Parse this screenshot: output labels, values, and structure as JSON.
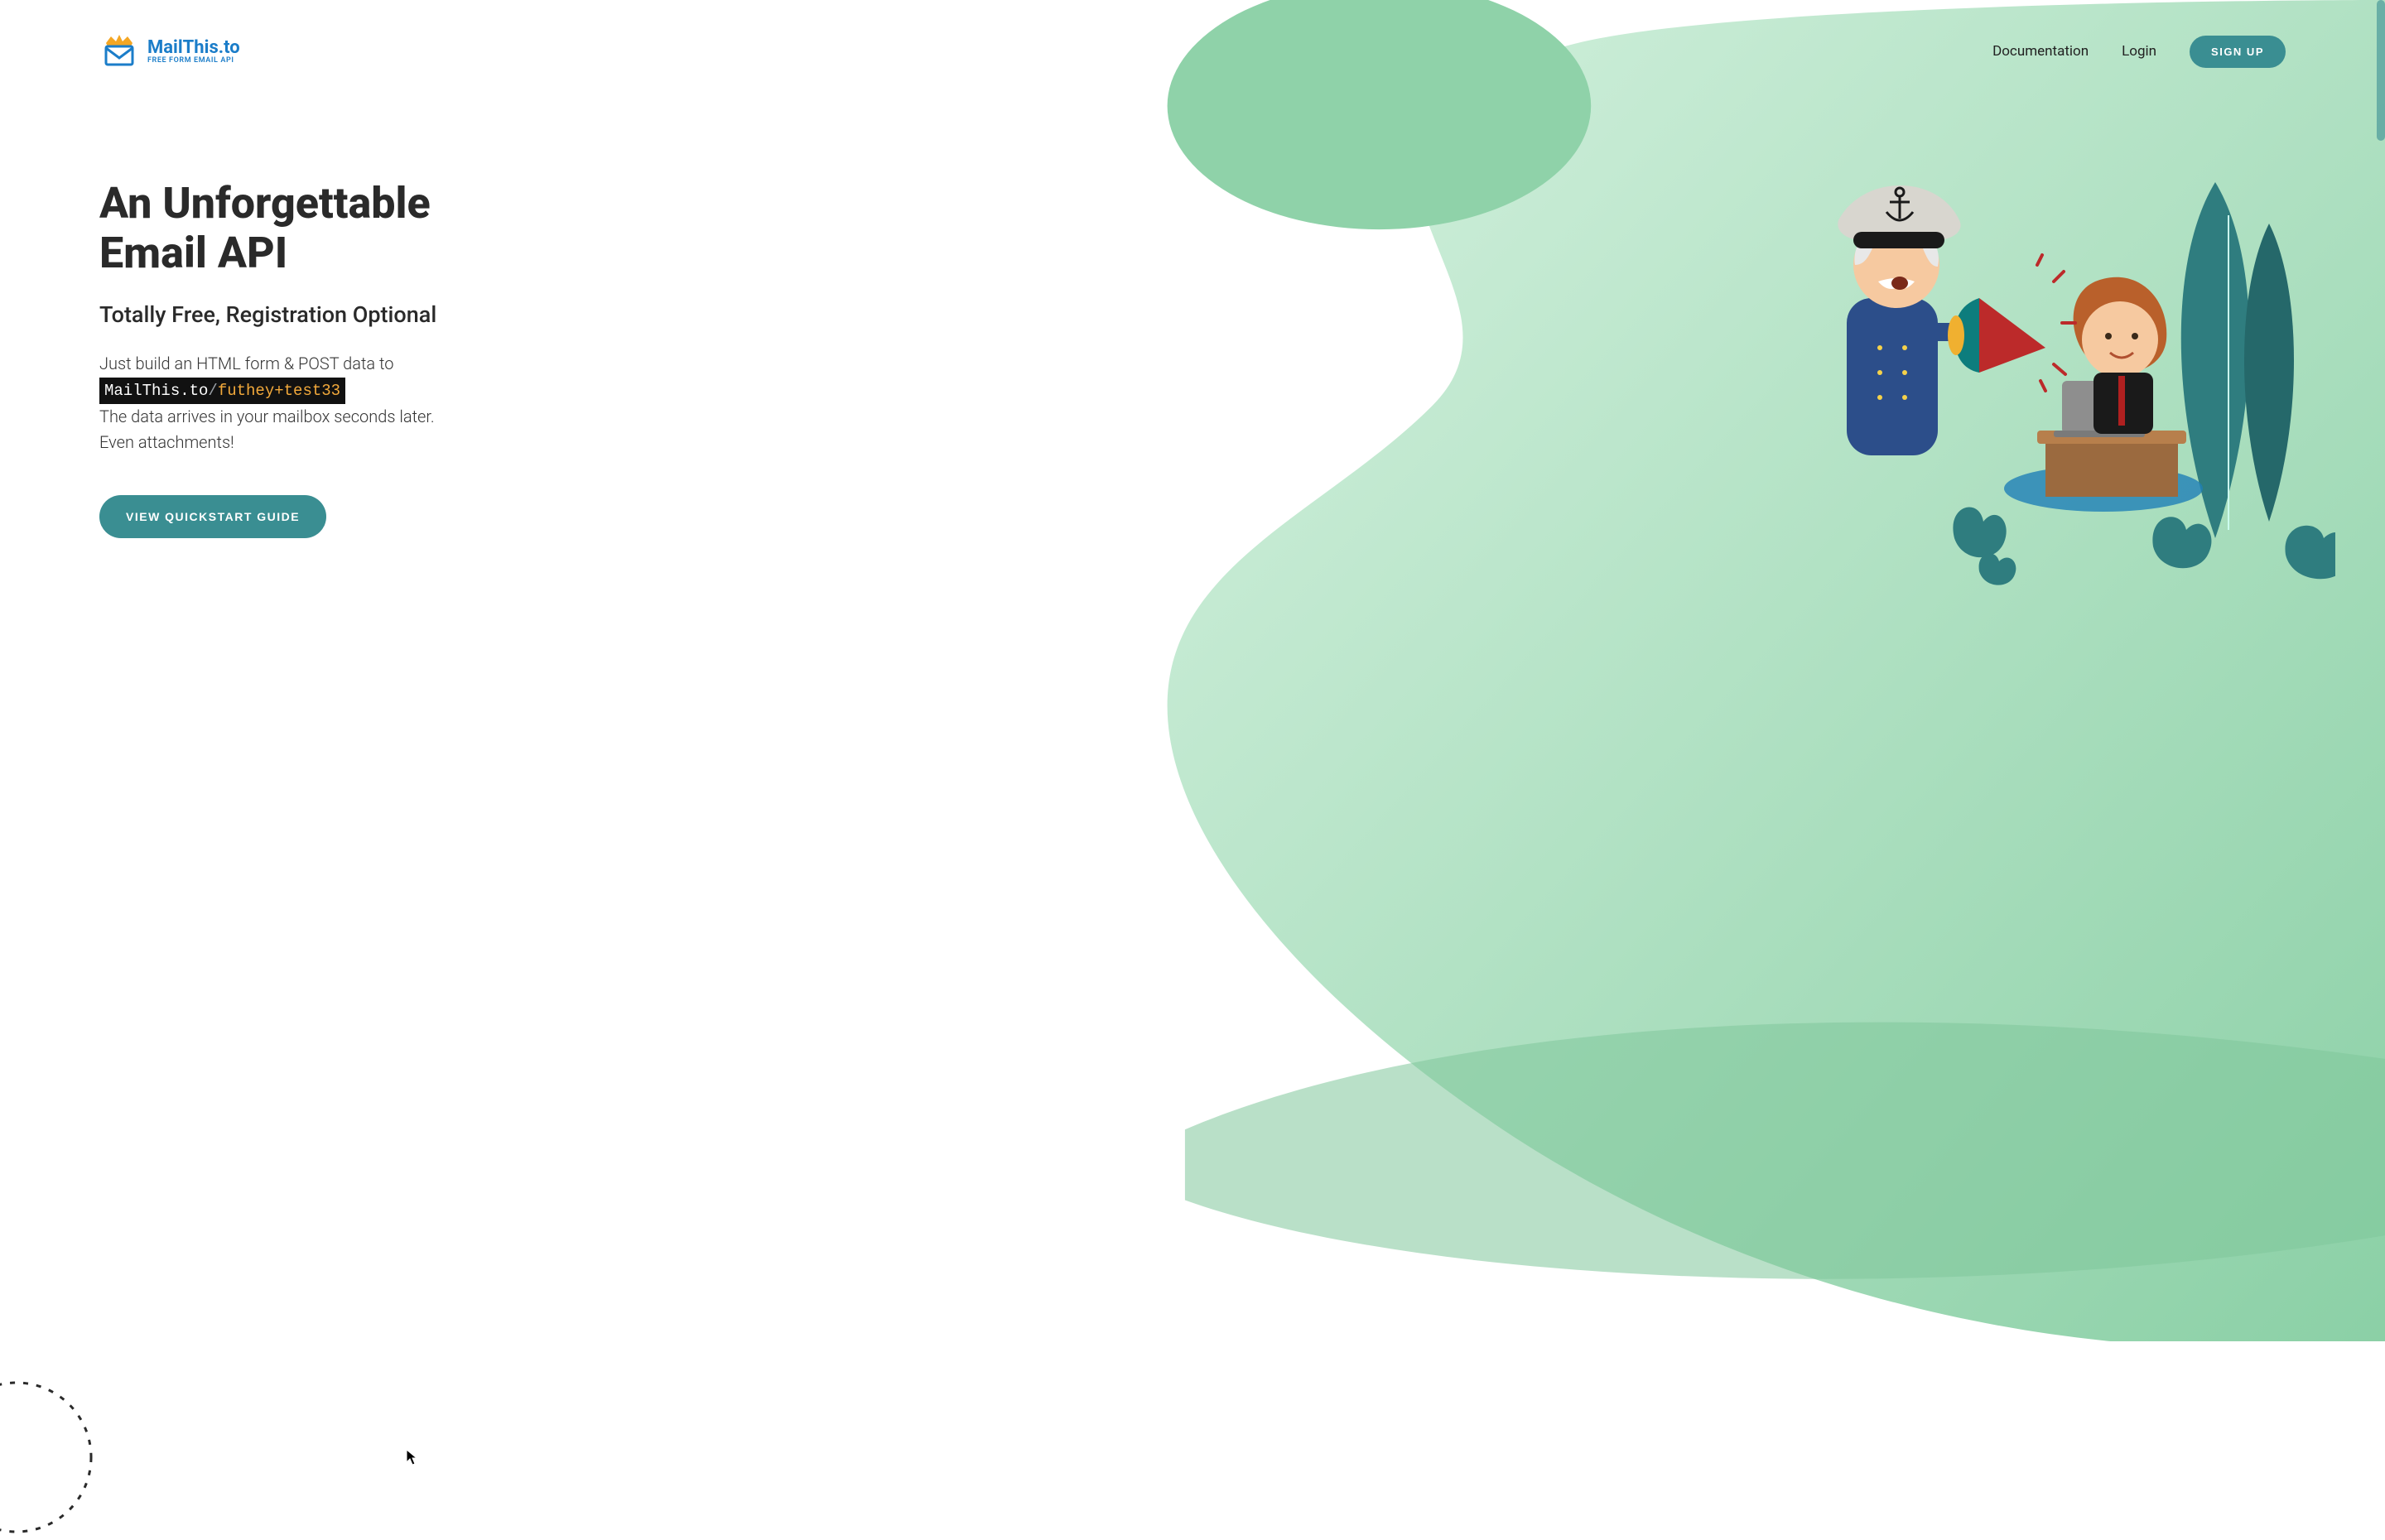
{
  "brand": {
    "name": "MailThis.to",
    "tagline": "FREE FORM EMAIL API"
  },
  "nav": {
    "documentation": "Documentation",
    "login": "Login",
    "signup": "SIGN UP"
  },
  "hero": {
    "title": "An Unforgettable Email API",
    "subtitle": "Totally Free, Registration Optional",
    "desc_before": "Just build an HTML form & POST data to",
    "code_host": "MailThis.to",
    "code_slash": "/",
    "code_alias": "futhey+test33",
    "desc_after1": "The data arrives in your mailbox seconds later.",
    "desc_after2": "Even attachments!",
    "cta": "VIEW QUICKSTART GUIDE"
  },
  "colors": {
    "accent": "#3a8e92",
    "blob_light": "#c9ecd6",
    "blob_dark": "#97d4ad",
    "brand_blue": "#1b7dc9"
  }
}
